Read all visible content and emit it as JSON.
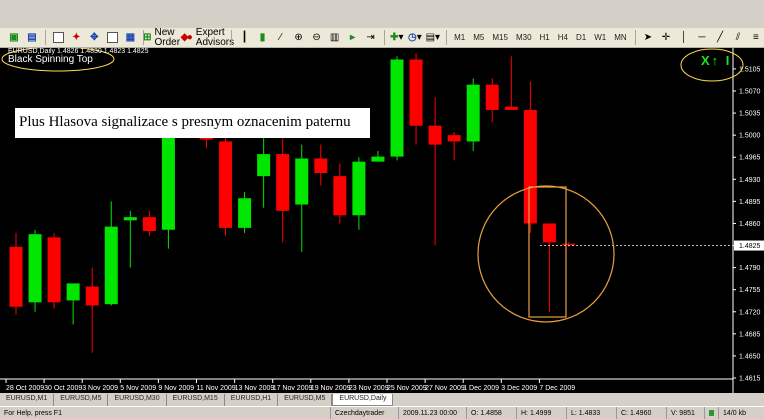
{
  "toolbar": {
    "new_order_label": "New Order",
    "expert_advisors_label": "Expert Advisors",
    "timeframes": [
      "M1",
      "M5",
      "M15",
      "M30",
      "H1",
      "H4",
      "D1",
      "W1",
      "MN"
    ]
  },
  "chart": {
    "symbol_info": "EURUSD,Daily  1.4826 1.4830 1.4823 1.4825",
    "indicator_name": "Black Spinning Top",
    "annotation": "Plus Hlasova signalizace s presnym oznacenim paternu",
    "signal_marker": "X↑ I",
    "current_price_label": "1.4825",
    "colors": {
      "bull": "#00e600",
      "bear": "#ff0000",
      "background": "#000000",
      "highlight_ellipse": "#ffdd55",
      "circle": "#e8a040",
      "rect": "#e8a040"
    }
  },
  "chart_data": {
    "type": "candlestick",
    "ylim": [
      1.4615,
      1.5135
    ],
    "y_ticks": [
      "1.5105",
      "1.5070",
      "1.5035",
      "1.5000",
      "1.4965",
      "1.4930",
      "1.4895",
      "1.4860",
      "1.4825",
      "1.4790",
      "1.4755",
      "1.4720",
      "1.4685",
      "1.4650",
      "1.4615"
    ],
    "x_ticks": [
      "28 Oct 2009",
      "30 Oct 2009",
      "3 Nov 2009",
      "5 Nov 2009",
      "9 Nov 2009",
      "11 Nov 2009",
      "13 Nov 2009",
      "17 Nov 2009",
      "19 Nov 2009",
      "23 Nov 2009",
      "25 Nov 2009",
      "27 Nov 2009",
      "1 Dec 2009",
      "3 Dec 2009",
      "7 Dec 2009"
    ],
    "candles": [
      {
        "o": 1.4823,
        "h": 1.4845,
        "l": 1.4715,
        "c": 1.4728
      },
      {
        "o": 1.4735,
        "h": 1.485,
        "l": 1.472,
        "c": 1.4843
      },
      {
        "o": 1.4838,
        "h": 1.4845,
        "l": 1.4725,
        "c": 1.4735
      },
      {
        "o": 1.4738,
        "h": 1.476,
        "l": 1.47,
        "c": 1.4765
      },
      {
        "o": 1.476,
        "h": 1.479,
        "l": 1.4655,
        "c": 1.473
      },
      {
        "o": 1.4732,
        "h": 1.4895,
        "l": 1.473,
        "c": 1.4855
      },
      {
        "o": 1.4865,
        "h": 1.488,
        "l": 1.479,
        "c": 1.487
      },
      {
        "o": 1.487,
        "h": 1.488,
        "l": 1.484,
        "c": 1.4848
      },
      {
        "o": 1.485,
        "h": 1.502,
        "l": 1.482,
        "c": 1.5
      },
      {
        "o": 1.5,
        "h": 1.503,
        "l": 1.4995,
        "c": 1.4998
      },
      {
        "o": 1.4997,
        "h": 1.503,
        "l": 1.498,
        "c": 1.4993
      },
      {
        "o": 1.499,
        "h": 1.501,
        "l": 1.484,
        "c": 1.4853
      },
      {
        "o": 1.4853,
        "h": 1.491,
        "l": 1.4845,
        "c": 1.49
      },
      {
        "o": 1.4935,
        "h": 1.501,
        "l": 1.4885,
        "c": 1.497
      },
      {
        "o": 1.497,
        "h": 1.4995,
        "l": 1.483,
        "c": 1.488
      },
      {
        "o": 1.489,
        "h": 1.4985,
        "l": 1.4815,
        "c": 1.4963
      },
      {
        "o": 1.4963,
        "h": 1.4985,
        "l": 1.492,
        "c": 1.494
      },
      {
        "o": 1.4935,
        "h": 1.4955,
        "l": 1.486,
        "c": 1.4873
      },
      {
        "o": 1.4873,
        "h": 1.4965,
        "l": 1.485,
        "c": 1.4958
      },
      {
        "o": 1.4958,
        "h": 1.4975,
        "l": 1.496,
        "c": 1.4966
      },
      {
        "o": 1.4966,
        "h": 1.5125,
        "l": 1.496,
        "c": 1.512
      },
      {
        "o": 1.512,
        "h": 1.513,
        "l": 1.4985,
        "c": 1.5015
      },
      {
        "o": 1.5015,
        "h": 1.506,
        "l": 1.4825,
        "c": 1.4985
      },
      {
        "o": 1.5,
        "h": 1.5005,
        "l": 1.496,
        "c": 1.499
      },
      {
        "o": 1.499,
        "h": 1.509,
        "l": 1.4975,
        "c": 1.508
      },
      {
        "o": 1.508,
        "h": 1.509,
        "l": 1.502,
        "c": 1.504
      },
      {
        "o": 1.5045,
        "h": 1.5125,
        "l": 1.504,
        "c": 1.504
      },
      {
        "o": 1.504,
        "h": 1.5085,
        "l": 1.4845,
        "c": 1.486
      },
      {
        "o": 1.486,
        "h": 1.486,
        "l": 1.472,
        "c": 1.483
      },
      {
        "o": 1.4828,
        "h": 1.483,
        "l": 1.4823,
        "c": 1.4826
      }
    ]
  },
  "tabs": [
    "EURUSD,M1",
    "EURUSD,M5",
    "EURUSD,M30",
    "EURUSD,M15",
    "EURUSD,H1",
    "EURUSD,M5",
    "EURUSD,Daily"
  ],
  "active_tab": 6,
  "status": {
    "help": "For Help, press F1",
    "profile": "Czechdaytrader",
    "datetime": "2009.11.23 00:00",
    "open": "O: 1.4858",
    "high": "H: 1.4999",
    "low": "L: 1.4833",
    "close": "C: 1.4960",
    "volume": "V: 9851",
    "traffic": "14/0 kb"
  }
}
